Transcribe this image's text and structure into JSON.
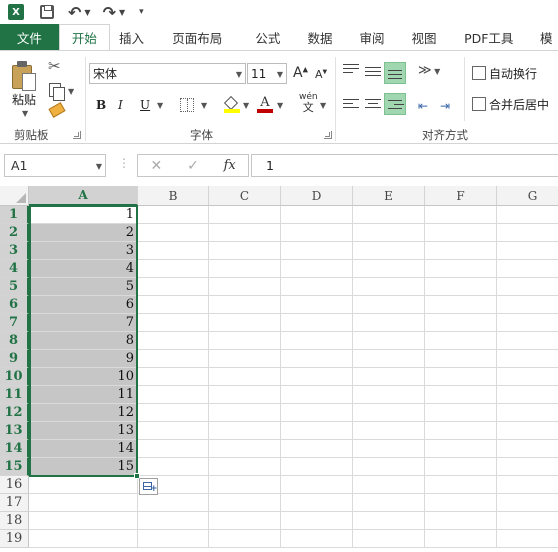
{
  "ribbon": {
    "tabs": [
      "文件",
      "开始",
      "插入",
      "页面布局",
      "公式",
      "数据",
      "审阅",
      "视图",
      "PDF工具",
      "模"
    ],
    "clipboard": {
      "paste_label": "粘贴",
      "group_label": "剪贴板"
    },
    "font": {
      "font_name": "宋体",
      "font_size": "11",
      "group_label": "字体",
      "grow": "A",
      "shrink": "A",
      "bold": "B",
      "italic": "I",
      "underline": "U",
      "font_color_glyph": "A",
      "phonetic_top": "wén",
      "phonetic_bottom": "文"
    },
    "alignment": {
      "wrap_text": "自动换行",
      "merge_center": "合并后居中",
      "group_label": "对齐方式"
    }
  },
  "formula_bar": {
    "name_box": "A1",
    "fx": "fx",
    "value": "1"
  },
  "grid": {
    "columns": [
      {
        "letter": "A",
        "selected": true
      },
      {
        "letter": "B",
        "selected": false
      },
      {
        "letter": "C",
        "selected": false
      },
      {
        "letter": "D",
        "selected": false
      },
      {
        "letter": "E",
        "selected": false
      },
      {
        "letter": "F",
        "selected": false
      },
      {
        "letter": "G",
        "selected": false
      }
    ],
    "rows": [
      "1",
      "2",
      "3",
      "4",
      "5",
      "6",
      "7",
      "8",
      "9",
      "10",
      "11",
      "12",
      "13",
      "14",
      "15",
      "16",
      "17",
      "18",
      "19"
    ],
    "selected_rows": 15,
    "column_a_values": [
      "1",
      "2",
      "3",
      "4",
      "5",
      "6",
      "7",
      "8",
      "9",
      "10",
      "11",
      "12",
      "13",
      "14",
      "15"
    ]
  },
  "colors": {
    "excel_green": "#217346",
    "selection_gray": "#c6c6c6",
    "highlight_yellow": "#ffff00",
    "font_red": "#c00000"
  }
}
